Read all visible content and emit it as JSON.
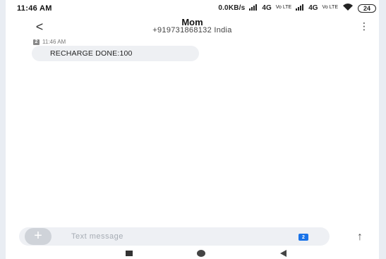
{
  "status_bar": {
    "time": "11:46 AM",
    "net_speed": "0.0KB/s",
    "network_1": "4G",
    "network_2": "4G",
    "volte_label": "Vo LTE",
    "battery": "24"
  },
  "header": {
    "back_icon": "back-chevron-icon",
    "title": "Mom",
    "subtitle": "+919731868132 India",
    "menu_icon": "more-vert-icon"
  },
  "messages": [
    {
      "sim": "2",
      "time": "11:46 AM",
      "text": "RECHARGE DONE:100"
    }
  ],
  "composer": {
    "add_icon": "plus-icon",
    "placeholder": "Text message",
    "sim_selector": "2",
    "send_icon": "arrow-up-icon"
  },
  "nav_bar": {
    "recents_icon": "square-icon",
    "home_icon": "circle-icon",
    "back_icon": "triangle-back-icon"
  },
  "colors": {
    "bubble": "#eef0f3",
    "composer_bg": "#eef0f4",
    "accent": "#1a73e8",
    "edge": "#e9edf3"
  }
}
